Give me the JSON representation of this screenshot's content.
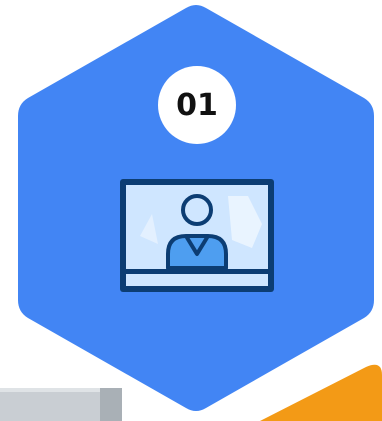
{
  "card": {
    "step_number": "01",
    "icon": "video-call-icon"
  },
  "colors": {
    "hexagon": "#4285f4",
    "badge": "#ffffff",
    "icon_fill": "#cfe6ff",
    "icon_outline": "#0c3d73",
    "accent_corner": "#f39a16",
    "photo_strip": "#c8cdd2"
  }
}
